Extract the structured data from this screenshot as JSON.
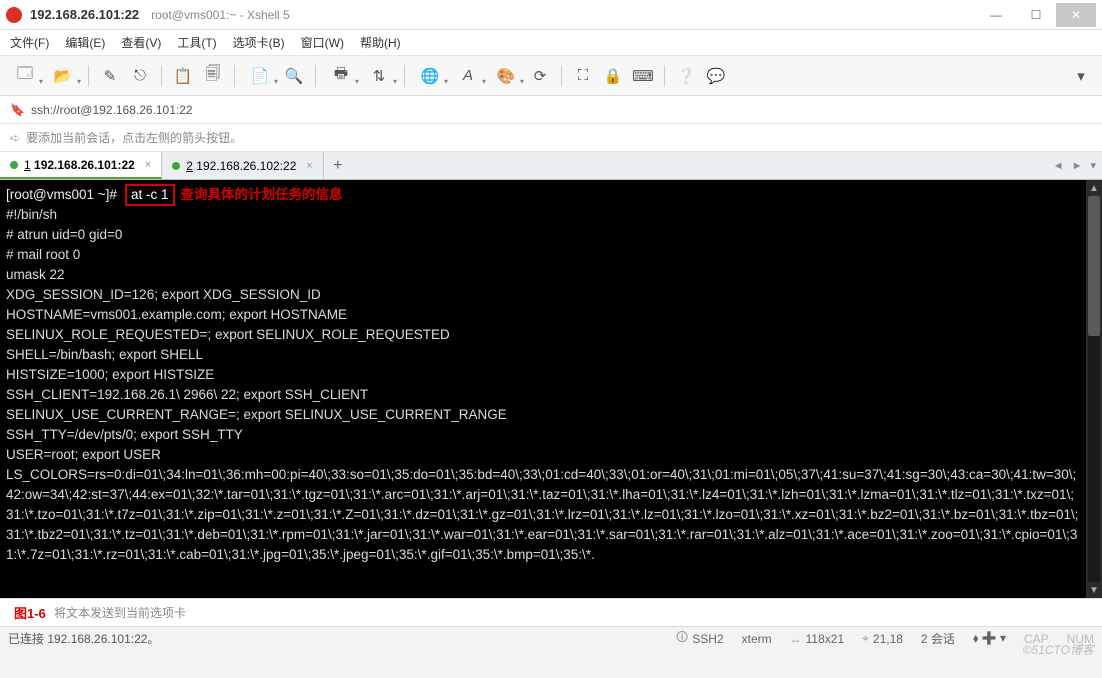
{
  "window": {
    "host": "192.168.26.101:22",
    "subtitle": "root@vms001:~ - Xshell 5"
  },
  "menu": {
    "file": "文件(F)",
    "edit": "编辑(E)",
    "view": "查看(V)",
    "tools": "工具(T)",
    "tabs": "选项卡(B)",
    "window": "窗口(W)",
    "help": "帮助(H)"
  },
  "address": {
    "url": "ssh://root@192.168.26.101:22"
  },
  "hint": {
    "text": "要添加当前会话，点击左侧的箭头按钮。"
  },
  "tabs": [
    {
      "index": "1",
      "label": "192.168.26.101:22",
      "active": true
    },
    {
      "index": "2",
      "label": "192.168.26.102:22",
      "active": false
    }
  ],
  "terminal": {
    "prompt": "[root@vms001 ~]#",
    "command": "at -c 1",
    "annotation": "查询具体的计划任务的信息",
    "lines": [
      "#!/bin/sh",
      "# atrun uid=0 gid=0",
      "# mail root 0",
      "umask 22",
      "XDG_SESSION_ID=126; export XDG_SESSION_ID",
      "HOSTNAME=vms001.example.com; export HOSTNAME",
      "SELINUX_ROLE_REQUESTED=; export SELINUX_ROLE_REQUESTED",
      "SHELL=/bin/bash; export SHELL",
      "HISTSIZE=1000; export HISTSIZE",
      "SSH_CLIENT=192.168.26.1\\ 2966\\ 22; export SSH_CLIENT",
      "SELINUX_USE_CURRENT_RANGE=; export SELINUX_USE_CURRENT_RANGE",
      "SSH_TTY=/dev/pts/0; export SSH_TTY",
      "USER=root; export USER"
    ],
    "lscolors": "LS_COLORS=rs=0:di=01\\;34:ln=01\\;36:mh=00:pi=40\\;33:so=01\\;35:do=01\\;35:bd=40\\;33\\;01:cd=40\\;33\\;01:or=40\\;31\\;01:mi=01\\;05\\;37\\;41:su=37\\;41:sg=30\\;43:ca=30\\;41:tw=30\\;42:ow=34\\;42:st=37\\;44:ex=01\\;32:\\*.tar=01\\;31:\\*.tgz=01\\;31:\\*.arc=01\\;31:\\*.arj=01\\;31:\\*.taz=01\\;31:\\*.lha=01\\;31:\\*.lz4=01\\;31:\\*.lzh=01\\;31:\\*.lzma=01\\;31:\\*.tlz=01\\;31:\\*.txz=01\\;31:\\*.tzo=01\\;31:\\*.t7z=01\\;31:\\*.zip=01\\;31:\\*.z=01\\;31:\\*.Z=01\\;31:\\*.dz=01\\;31:\\*.gz=01\\;31:\\*.lrz=01\\;31:\\*.lz=01\\;31:\\*.lzo=01\\;31:\\*.xz=01\\;31:\\*.bz2=01\\;31:\\*.bz=01\\;31:\\*.tbz=01\\;31:\\*.tbz2=01\\;31:\\*.tz=01\\;31:\\*.deb=01\\;31:\\*.rpm=01\\;31:\\*.jar=01\\;31:\\*.war=01\\;31:\\*.ear=01\\;31:\\*.sar=01\\;31:\\*.rar=01\\;31:\\*.alz=01\\;31:\\*.ace=01\\;31:\\*.zoo=01\\;31:\\*.cpio=01\\;31:\\*.7z=01\\;31:\\*.rz=01\\;31:\\*.cab=01\\;31:\\*.jpg=01\\;35:\\*.jpeg=01\\;35:\\*.gif=01\\;35:\\*.bmp=01\\;35:\\*."
  },
  "inputbar": {
    "placeholder": "将文本发送到当前选项卡",
    "figure": "图1-6"
  },
  "status": {
    "connected": "已连接 192.168.26.101:22。",
    "proto": "SSH2",
    "termtype": "xterm",
    "size": "118x21",
    "cursor": "21,18",
    "sessions_label": "2 会话",
    "caps": "CAP",
    "num": "NUM"
  },
  "watermark": "©51CTO博客"
}
